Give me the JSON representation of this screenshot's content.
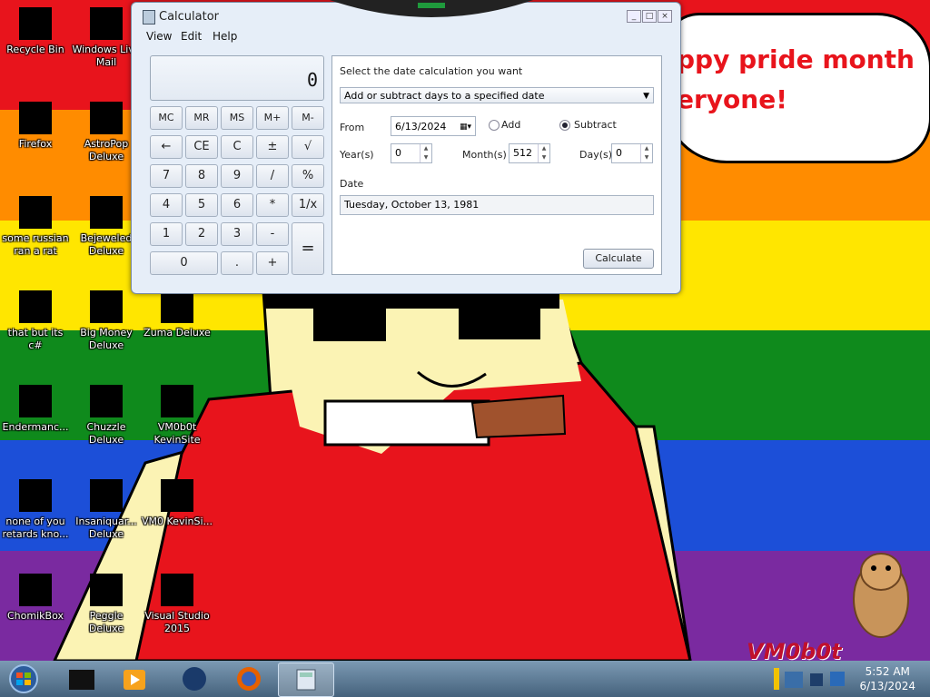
{
  "desktop": {
    "background_stripes": [
      "#e8141c",
      "#ff8c00",
      "#ffe600",
      "#0f8a1c",
      "#1c4fd8",
      "#7a2aa0"
    ],
    "speech_lines": [
      "ppy pride month",
      "eryone!"
    ],
    "watermark": "VM0b0t",
    "icons": [
      {
        "label": "Recycle Bin",
        "icon": "recycle-bin-icon"
      },
      {
        "label": "Windows Live Mail",
        "icon": "mail-icon"
      },
      {
        "label": "Firefox",
        "icon": "firefox-icon"
      },
      {
        "label": "AstroPop Deluxe",
        "icon": "astropop-icon"
      },
      {
        "label": "some russian ran a rat",
        "icon": "rat-icon"
      },
      {
        "label": "Bejeweled Deluxe",
        "icon": "bejeweled-icon"
      },
      {
        "label": "that but its c#",
        "icon": "csharp-icon"
      },
      {
        "label": "Big Money Deluxe",
        "icon": "bigmoney-icon"
      },
      {
        "label": "Zuma Deluxe",
        "icon": "zuma-icon"
      },
      {
        "label": "Endermanc...",
        "icon": "program-icon"
      },
      {
        "label": "Chuzzle Deluxe",
        "icon": "chuzzle-icon"
      },
      {
        "label": "VM0b0t KevinSite",
        "icon": "link-icon"
      },
      {
        "label": "none of you retards kno...",
        "icon": "program-icon"
      },
      {
        "label": "Insaniquar... Deluxe",
        "icon": "insaniquarium-icon"
      },
      {
        "label": "VM0 KevinSi...",
        "icon": "link-icon"
      },
      {
        "label": "ChomikBox",
        "icon": "chomikbox-icon"
      },
      {
        "label": "Peggle Deluxe",
        "icon": "peggle-icon"
      },
      {
        "label": "Visual Studio 2015",
        "icon": "visual-studio-icon"
      }
    ]
  },
  "calculator": {
    "title": "Calculator",
    "menu": [
      "View",
      "Edit",
      "Help"
    ],
    "display": "0",
    "keys": [
      [
        "MC",
        "MR",
        "MS",
        "M+",
        "M-"
      ],
      [
        "←",
        "CE",
        "C",
        "±",
        "√"
      ],
      [
        "7",
        "8",
        "9",
        "/",
        "%"
      ],
      [
        "4",
        "5",
        "6",
        "*",
        "1/x"
      ],
      [
        "1",
        "2",
        "3",
        "-",
        "="
      ],
      [
        "0",
        ".",
        "+"
      ]
    ],
    "date_panel": {
      "prompt": "Select the date calculation you want",
      "mode": "Add or subtract days to a specified date",
      "from_label": "From",
      "from_value": "6/13/2024",
      "add_label": "Add",
      "subtract_label": "Subtract",
      "selected": "Subtract",
      "years_label": "Year(s)",
      "years_value": "0",
      "months_label": "Month(s)",
      "months_value": "512",
      "days_label": "Day(s)",
      "days_value": "0",
      "date_label": "Date",
      "date_value": "Tuesday, October 13, 1981",
      "calculate_label": "Calculate"
    }
  },
  "taskbar": {
    "time": "5:52 AM",
    "date": "6/13/2024",
    "buttons": [
      "start-orb-icon",
      "folder-icon",
      "media-player-icon",
      "globe-icon",
      "firefox-icon",
      "calculator-icon"
    ]
  }
}
